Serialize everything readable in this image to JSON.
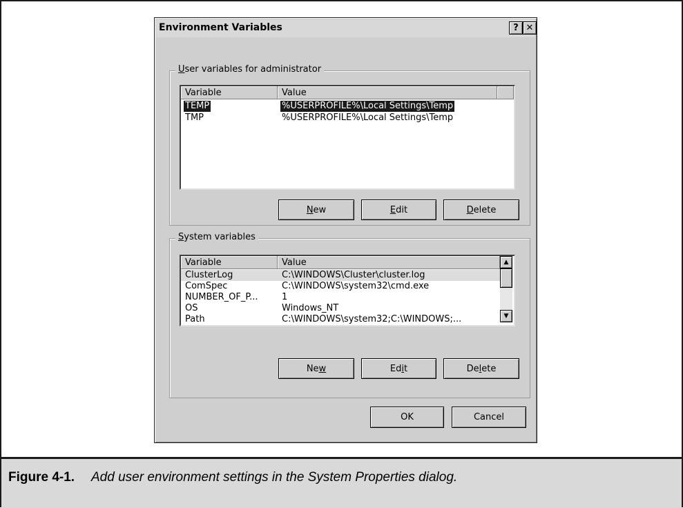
{
  "dialog": {
    "title": "Environment Variables",
    "help_glyph": "?",
    "close_glyph": "✕"
  },
  "user_group": {
    "legend_mnemonic": "U",
    "legend_rest": "ser variables for administrator",
    "columns": [
      "Variable",
      "Value"
    ],
    "rows": [
      {
        "variable": "TEMP",
        "value": "%USERPROFILE%\\Local Settings\\Temp"
      },
      {
        "variable": "TMP",
        "value": "%USERPROFILE%\\Local Settings\\Temp"
      }
    ],
    "buttons": {
      "new_mn": "N",
      "new_rest": "ew",
      "edit_mn": "E",
      "edit_rest": "dit",
      "delete_mn": "D",
      "delete_rest": "elete"
    }
  },
  "system_group": {
    "legend_mnemonic": "S",
    "legend_rest": "ystem variables",
    "columns": [
      "Variable",
      "Value"
    ],
    "rows": [
      {
        "variable": "ClusterLog",
        "value": "C:\\WINDOWS\\Cluster\\cluster.log"
      },
      {
        "variable": "ComSpec",
        "value": "C:\\WINDOWS\\system32\\cmd.exe"
      },
      {
        "variable": "NUMBER_OF_P...",
        "value": "1"
      },
      {
        "variable": "OS",
        "value": "Windows_NT"
      },
      {
        "variable": "Path",
        "value": "C:\\WINDOWS\\system32;C:\\WINDOWS;..."
      }
    ],
    "buttons": {
      "new_a": "Ne",
      "new_mn": "w",
      "new_b": "",
      "edit_a": "Ed",
      "edit_mn": "i",
      "edit_b": "t",
      "delete_a": "De",
      "delete_mn": "l",
      "delete_b": "ete"
    },
    "scroll_up_glyph": "▲",
    "scroll_down_glyph": "▼"
  },
  "footer": {
    "ok": "OK",
    "cancel": "Cancel"
  },
  "caption": {
    "number": "Figure 4-1.",
    "text": "Add user environment settings in the System Properties dialog."
  }
}
